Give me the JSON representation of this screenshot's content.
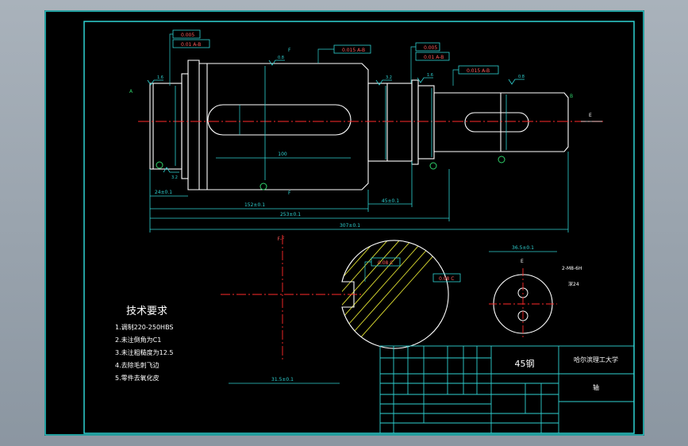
{
  "colors": {
    "background": "#000000",
    "border": "#2fd2d2",
    "outline": "#ffffff",
    "center_line": "#ff2a2a",
    "dimension": "#2fd2d2",
    "hatch": "#e6e633",
    "label": "#ffffff",
    "datum_mark": "#2fd26a",
    "gdt_frame": "#ff5c5c"
  },
  "title_block": {
    "material": "45钢",
    "school": "哈尔滨理工大学",
    "part_name": "轴"
  },
  "tech_requirements": {
    "heading": "技术要求",
    "items": [
      "1.调制220-250HBS",
      "2.未注倒角为C1",
      "3.未注粗糙度为12.5",
      "4.去除毛刺飞边",
      "5.零件去氧化皮"
    ]
  },
  "dimensions": {
    "overall_length": "307±0.1",
    "length_a": "253±0.1",
    "length_b": "152±0.1",
    "length_c": "45±0.1",
    "length_d": "24±0.1",
    "keyway_length": "100",
    "section_size": "31.5±0.1",
    "section_key": "36.5±0.1",
    "end_thread": "2-M8-6H",
    "thread_depth": "深24"
  },
  "gdt_frames": [
    "0.005",
    "0.01  A-B",
    "0.015  A-B",
    "0.005",
    "0.01  A-B",
    "0.015  A-B",
    "0.08  C",
    "0.08  C"
  ],
  "roughness_values": [
    "1.6",
    "0.8",
    "3.2",
    "1.6",
    "0.8",
    "3.2"
  ],
  "labels": {
    "datum_a": "A",
    "datum_b": "B",
    "datum_c": "C",
    "section_cut": "F",
    "section_title": "F-F",
    "view_e": "E",
    "view_arrow": "E"
  }
}
